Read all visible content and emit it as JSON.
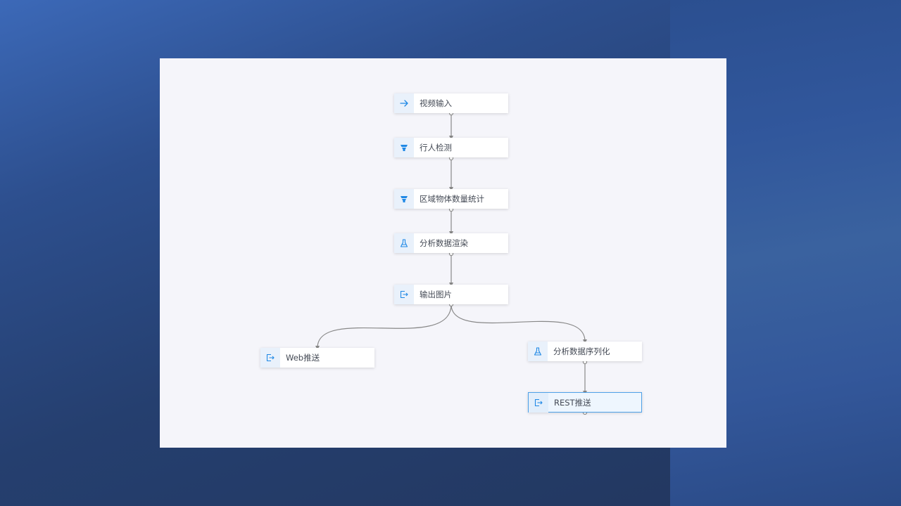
{
  "colors": {
    "accent": "#1e88e5",
    "edge": "#888888",
    "selected_border": "#4fa1e8"
  },
  "nodes": [
    {
      "id": "n1",
      "label": "视频输入",
      "icon": "arrow-right-icon"
    },
    {
      "id": "n2",
      "label": "行人检测",
      "icon": "funnel-icon"
    },
    {
      "id": "n3",
      "label": "区域物体数量统计",
      "icon": "funnel-icon"
    },
    {
      "id": "n4",
      "label": "分析数据渲染",
      "icon": "flask-icon"
    },
    {
      "id": "n5",
      "label": "输出图片",
      "icon": "export-icon"
    },
    {
      "id": "n6",
      "label": "Web推送",
      "icon": "export-icon"
    },
    {
      "id": "n7",
      "label": "分析数据序列化",
      "icon": "flask-icon"
    },
    {
      "id": "n8",
      "label": "REST推送",
      "icon": "export-icon",
      "selected": true
    }
  ],
  "edges": [
    {
      "from": "n1",
      "to": "n2"
    },
    {
      "from": "n2",
      "to": "n3"
    },
    {
      "from": "n3",
      "to": "n4"
    },
    {
      "from": "n4",
      "to": "n5"
    },
    {
      "from": "n5",
      "to": "n6"
    },
    {
      "from": "n5",
      "to": "n7"
    },
    {
      "from": "n7",
      "to": "n8"
    }
  ]
}
